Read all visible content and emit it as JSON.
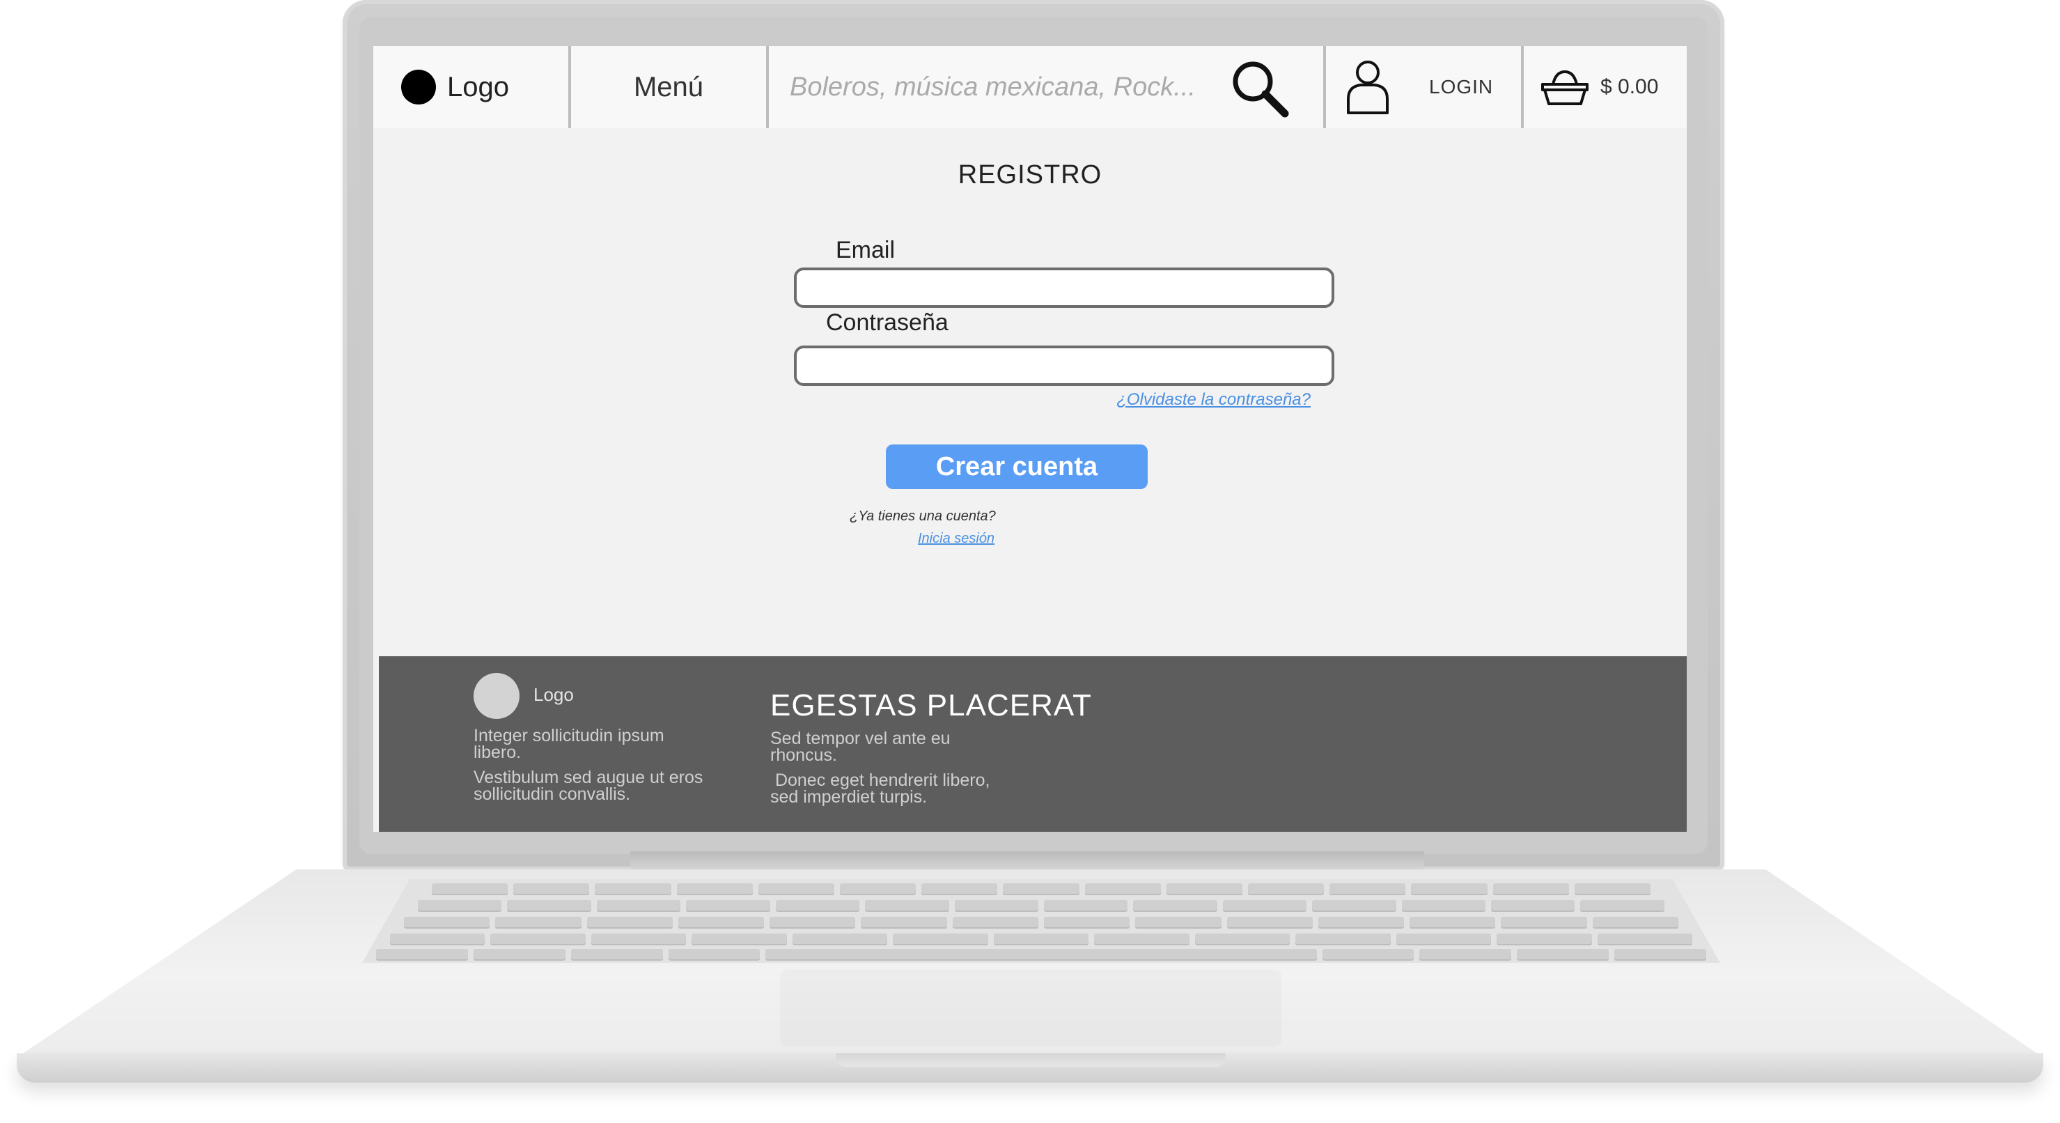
{
  "header": {
    "logo_label": "Logo",
    "menu_label": "Menú",
    "search_placeholder": "Boleros, música mexicana, Rock...",
    "login_label": "LOGIN",
    "cart_total": "$ 0.00"
  },
  "form": {
    "title": "REGISTRO",
    "email_label": "Email",
    "password_label": "Contraseña",
    "forgot_link": "¿Olvidaste la contraseña?",
    "create_button": "Crear cuenta",
    "have_account": "¿Ya tienes una cuenta?",
    "login_link": "Inicia sesión"
  },
  "footer": {
    "logo_label": "Logo",
    "text1a": "Integer sollicitudin ipsum",
    "text1b": "libero.",
    "text2a": "Vestibulum sed augue ut eros",
    "text2b": "sollicitudin convallis.",
    "heading": "EGESTAS PLACERAT",
    "text3a": "Sed tempor vel ante eu",
    "text3b": "rhoncus.",
    "text4a": " Donec eget hendrerit libero,",
    "text4b": "sed imperdiet turpis."
  },
  "colors": {
    "button": "#5a9df4",
    "link": "#4a90e2",
    "footer_bg": "#5e5d5e",
    "screen_bg": "#f2f2f2"
  },
  "icons": [
    "logo-dot",
    "search-icon",
    "user-icon",
    "basket-icon",
    "footer-logo-dot"
  ]
}
